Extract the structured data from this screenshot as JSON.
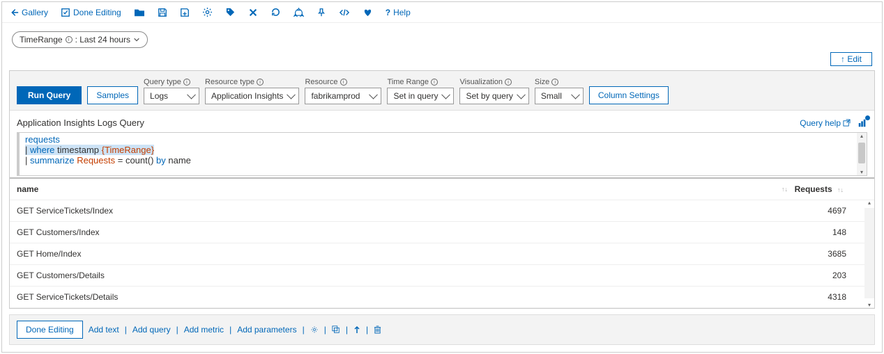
{
  "topbar": {
    "gallery": "Gallery",
    "done_editing": "Done Editing",
    "help": "Help"
  },
  "time_pill": {
    "label": "TimeRange",
    "value": ": Last 24 hours"
  },
  "edit_button": "↑ Edit",
  "query_panel": {
    "run": "Run Query",
    "samples": "Samples",
    "column_settings": "Column Settings",
    "fields": {
      "query_type": {
        "label": "Query type",
        "value": "Logs"
      },
      "resource_type": {
        "label": "Resource type",
        "value": "Application Insights"
      },
      "resource": {
        "label": "Resource",
        "value": "fabrikamprod"
      },
      "time_range": {
        "label": "Time Range",
        "value": "Set in query"
      },
      "visualization": {
        "label": "Visualization",
        "value": "Set by query"
      },
      "size": {
        "label": "Size",
        "value": "Small"
      }
    }
  },
  "subtitle": "Application Insights Logs Query",
  "query_help": "Query help",
  "code": {
    "l1": "requests",
    "l2a": "where",
    "l2b": "timestamp",
    "l2c": "{TimeRange}",
    "l3a": "summarize",
    "l3b": "Requests",
    "l3c": " = ",
    "l3d": "count",
    "l3e": "() ",
    "l3f": "by",
    "l3g": " name"
  },
  "table": {
    "headers": {
      "name": "name",
      "requests": "Requests"
    },
    "rows": [
      {
        "name": "GET ServiceTickets/Index",
        "requests": "4697"
      },
      {
        "name": "GET Customers/Index",
        "requests": "148"
      },
      {
        "name": "GET Home/Index",
        "requests": "3685"
      },
      {
        "name": "GET Customers/Details",
        "requests": "203"
      },
      {
        "name": "GET ServiceTickets/Details",
        "requests": "4318"
      }
    ]
  },
  "footer": {
    "done": "Done Editing",
    "add_text": "Add text",
    "add_query": "Add query",
    "add_metric": "Add metric",
    "add_params": "Add parameters"
  }
}
